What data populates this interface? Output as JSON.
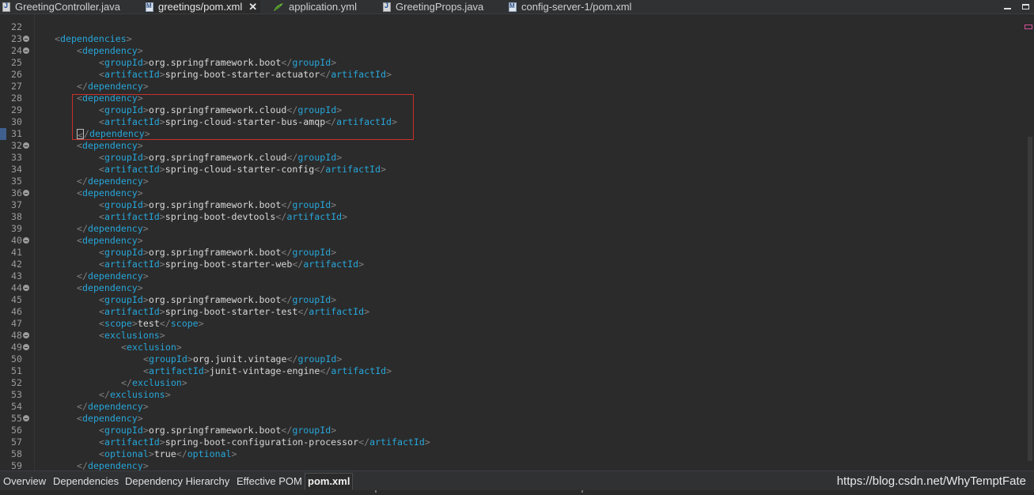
{
  "tabs": [
    {
      "label": "GreetingController.java",
      "icon": "java-file-icon",
      "active": false
    },
    {
      "label": "greetings/pom.xml",
      "icon": "maven-pom-icon",
      "active": true,
      "close": "✕"
    },
    {
      "label": "application.yml",
      "icon": "yaml-file-icon",
      "active": false
    },
    {
      "label": "GreetingProps.java",
      "icon": "java-file-icon",
      "active": false
    },
    {
      "label": "config-server-1/pom.xml",
      "icon": "maven-pom-icon",
      "active": false
    }
  ],
  "editor": {
    "lines": [
      {
        "n": "22",
        "indent": 0,
        "parts": []
      },
      {
        "n": "23",
        "fold": true,
        "indent": 1,
        "parts": [
          [
            "br",
            "<"
          ],
          [
            "tag",
            "dependencies"
          ],
          [
            "br",
            ">"
          ]
        ]
      },
      {
        "n": "24",
        "fold": true,
        "indent": 2,
        "parts": [
          [
            "br",
            "<"
          ],
          [
            "tag",
            "dependency"
          ],
          [
            "br",
            ">"
          ]
        ]
      },
      {
        "n": "25",
        "indent": 3,
        "parts": [
          [
            "br",
            "<"
          ],
          [
            "tag",
            "groupId"
          ],
          [
            "br",
            ">"
          ],
          [
            "txt",
            "org.springframework.boot"
          ],
          [
            "br",
            "</"
          ],
          [
            "tag",
            "groupId"
          ],
          [
            "br",
            ">"
          ]
        ]
      },
      {
        "n": "26",
        "indent": 3,
        "parts": [
          [
            "br",
            "<"
          ],
          [
            "tag",
            "artifactId"
          ],
          [
            "br",
            ">"
          ],
          [
            "txt",
            "spring-boot-starter-actuator"
          ],
          [
            "br",
            "</"
          ],
          [
            "tag",
            "artifactId"
          ],
          [
            "br",
            ">"
          ]
        ]
      },
      {
        "n": "27",
        "indent": 2,
        "parts": [
          [
            "br",
            "</"
          ],
          [
            "tag",
            "dependency"
          ],
          [
            "br",
            ">"
          ]
        ]
      },
      {
        "n": "28",
        "indent": 2,
        "parts": [
          [
            "br",
            "<"
          ],
          [
            "tag",
            "dependency"
          ],
          [
            "br",
            ">"
          ]
        ]
      },
      {
        "n": "29",
        "indent": 3,
        "parts": [
          [
            "br",
            "<"
          ],
          [
            "tag",
            "groupId"
          ],
          [
            "br",
            ">"
          ],
          [
            "txt",
            "org.springframework.cloud"
          ],
          [
            "br",
            "</"
          ],
          [
            "tag",
            "groupId"
          ],
          [
            "br",
            ">"
          ]
        ]
      },
      {
        "n": "30",
        "indent": 3,
        "parts": [
          [
            "br",
            "<"
          ],
          [
            "tag",
            "artifactId"
          ],
          [
            "br",
            ">"
          ],
          [
            "txt",
            "spring-cloud-starter-bus-amqp"
          ],
          [
            "br",
            "</"
          ],
          [
            "tag",
            "artifactId"
          ],
          [
            "br",
            ">"
          ]
        ]
      },
      {
        "n": "31",
        "indent": 2,
        "cursor": true,
        "parts": [
          [
            "br",
            "</"
          ],
          [
            "tag",
            "dependency"
          ],
          [
            "br",
            ">"
          ]
        ]
      },
      {
        "n": "32",
        "fold": true,
        "indent": 2,
        "parts": [
          [
            "br",
            "<"
          ],
          [
            "tag",
            "dependency"
          ],
          [
            "br",
            ">"
          ]
        ]
      },
      {
        "n": "33",
        "indent": 3,
        "parts": [
          [
            "br",
            "<"
          ],
          [
            "tag",
            "groupId"
          ],
          [
            "br",
            ">"
          ],
          [
            "txt",
            "org.springframework.cloud"
          ],
          [
            "br",
            "</"
          ],
          [
            "tag",
            "groupId"
          ],
          [
            "br",
            ">"
          ]
        ]
      },
      {
        "n": "34",
        "indent": 3,
        "parts": [
          [
            "br",
            "<"
          ],
          [
            "tag",
            "artifactId"
          ],
          [
            "br",
            ">"
          ],
          [
            "txt",
            "spring-cloud-starter-config"
          ],
          [
            "br",
            "</"
          ],
          [
            "tag",
            "artifactId"
          ],
          [
            "br",
            ">"
          ]
        ]
      },
      {
        "n": "35",
        "indent": 2,
        "parts": [
          [
            "br",
            "</"
          ],
          [
            "tag",
            "dependency"
          ],
          [
            "br",
            ">"
          ]
        ]
      },
      {
        "n": "36",
        "fold": true,
        "indent": 2,
        "parts": [
          [
            "br",
            "<"
          ],
          [
            "tag",
            "dependency"
          ],
          [
            "br",
            ">"
          ]
        ]
      },
      {
        "n": "37",
        "indent": 3,
        "parts": [
          [
            "br",
            "<"
          ],
          [
            "tag",
            "groupId"
          ],
          [
            "br",
            ">"
          ],
          [
            "txt",
            "org.springframework.boot"
          ],
          [
            "br",
            "</"
          ],
          [
            "tag",
            "groupId"
          ],
          [
            "br",
            ">"
          ]
        ]
      },
      {
        "n": "38",
        "indent": 3,
        "parts": [
          [
            "br",
            "<"
          ],
          [
            "tag",
            "artifactId"
          ],
          [
            "br",
            ">"
          ],
          [
            "txt",
            "spring-boot-devtools"
          ],
          [
            "br",
            "</"
          ],
          [
            "tag",
            "artifactId"
          ],
          [
            "br",
            ">"
          ]
        ]
      },
      {
        "n": "39",
        "indent": 2,
        "parts": [
          [
            "br",
            "</"
          ],
          [
            "tag",
            "dependency"
          ],
          [
            "br",
            ">"
          ]
        ]
      },
      {
        "n": "40",
        "fold": true,
        "indent": 2,
        "parts": [
          [
            "br",
            "<"
          ],
          [
            "tag",
            "dependency"
          ],
          [
            "br",
            ">"
          ]
        ]
      },
      {
        "n": "41",
        "indent": 3,
        "parts": [
          [
            "br",
            "<"
          ],
          [
            "tag",
            "groupId"
          ],
          [
            "br",
            ">"
          ],
          [
            "txt",
            "org.springframework.boot"
          ],
          [
            "br",
            "</"
          ],
          [
            "tag",
            "groupId"
          ],
          [
            "br",
            ">"
          ]
        ]
      },
      {
        "n": "42",
        "indent": 3,
        "parts": [
          [
            "br",
            "<"
          ],
          [
            "tag",
            "artifactId"
          ],
          [
            "br",
            ">"
          ],
          [
            "txt",
            "spring-boot-starter-web"
          ],
          [
            "br",
            "</"
          ],
          [
            "tag",
            "artifactId"
          ],
          [
            "br",
            ">"
          ]
        ]
      },
      {
        "n": "43",
        "indent": 2,
        "parts": [
          [
            "br",
            "</"
          ],
          [
            "tag",
            "dependency"
          ],
          [
            "br",
            ">"
          ]
        ]
      },
      {
        "n": "44",
        "fold": true,
        "indent": 2,
        "parts": [
          [
            "br",
            "<"
          ],
          [
            "tag",
            "dependency"
          ],
          [
            "br",
            ">"
          ]
        ]
      },
      {
        "n": "45",
        "indent": 3,
        "parts": [
          [
            "br",
            "<"
          ],
          [
            "tag",
            "groupId"
          ],
          [
            "br",
            ">"
          ],
          [
            "txt",
            "org.springframework.boot"
          ],
          [
            "br",
            "</"
          ],
          [
            "tag",
            "groupId"
          ],
          [
            "br",
            ">"
          ]
        ]
      },
      {
        "n": "46",
        "indent": 3,
        "parts": [
          [
            "br",
            "<"
          ],
          [
            "tag",
            "artifactId"
          ],
          [
            "br",
            ">"
          ],
          [
            "txt",
            "spring-boot-starter-test"
          ],
          [
            "br",
            "</"
          ],
          [
            "tag",
            "artifactId"
          ],
          [
            "br",
            ">"
          ]
        ]
      },
      {
        "n": "47",
        "indent": 3,
        "parts": [
          [
            "br",
            "<"
          ],
          [
            "tag",
            "scope"
          ],
          [
            "br",
            ">"
          ],
          [
            "txt",
            "test"
          ],
          [
            "br",
            "</"
          ],
          [
            "tag",
            "scope"
          ],
          [
            "br",
            ">"
          ]
        ]
      },
      {
        "n": "48",
        "fold": true,
        "indent": 3,
        "parts": [
          [
            "br",
            "<"
          ],
          [
            "tag",
            "exclusions"
          ],
          [
            "br",
            ">"
          ]
        ]
      },
      {
        "n": "49",
        "fold": true,
        "indent": 4,
        "parts": [
          [
            "br",
            "<"
          ],
          [
            "tag",
            "exclusion"
          ],
          [
            "br",
            ">"
          ]
        ]
      },
      {
        "n": "50",
        "indent": 5,
        "parts": [
          [
            "br",
            "<"
          ],
          [
            "tag",
            "groupId"
          ],
          [
            "br",
            ">"
          ],
          [
            "txt",
            "org.junit.vintage"
          ],
          [
            "br",
            "</"
          ],
          [
            "tag",
            "groupId"
          ],
          [
            "br",
            ">"
          ]
        ]
      },
      {
        "n": "51",
        "indent": 5,
        "parts": [
          [
            "br",
            "<"
          ],
          [
            "tag",
            "artifactId"
          ],
          [
            "br",
            ">"
          ],
          [
            "txt",
            "junit-vintage-engine"
          ],
          [
            "br",
            "</"
          ],
          [
            "tag",
            "artifactId"
          ],
          [
            "br",
            ">"
          ]
        ]
      },
      {
        "n": "52",
        "indent": 4,
        "parts": [
          [
            "br",
            "</"
          ],
          [
            "tag",
            "exclusion"
          ],
          [
            "br",
            ">"
          ]
        ]
      },
      {
        "n": "53",
        "indent": 3,
        "parts": [
          [
            "br",
            "</"
          ],
          [
            "tag",
            "exclusions"
          ],
          [
            "br",
            ">"
          ]
        ]
      },
      {
        "n": "54",
        "indent": 2,
        "parts": [
          [
            "br",
            "</"
          ],
          [
            "tag",
            "dependency"
          ],
          [
            "br",
            ">"
          ]
        ]
      },
      {
        "n": "55",
        "fold": true,
        "indent": 2,
        "parts": [
          [
            "br",
            "<"
          ],
          [
            "tag",
            "dependency"
          ],
          [
            "br",
            ">"
          ]
        ]
      },
      {
        "n": "56",
        "indent": 3,
        "parts": [
          [
            "br",
            "<"
          ],
          [
            "tag",
            "groupId"
          ],
          [
            "br",
            ">"
          ],
          [
            "txt",
            "org.springframework.boot"
          ],
          [
            "br",
            "</"
          ],
          [
            "tag",
            "groupId"
          ],
          [
            "br",
            ">"
          ]
        ]
      },
      {
        "n": "57",
        "indent": 3,
        "parts": [
          [
            "br",
            "<"
          ],
          [
            "tag",
            "artifactId"
          ],
          [
            "br",
            ">"
          ],
          [
            "txt",
            "spring-boot-configuration-processor"
          ],
          [
            "br",
            "</"
          ],
          [
            "tag",
            "artifactId"
          ],
          [
            "br",
            ">"
          ]
        ]
      },
      {
        "n": "58",
        "indent": 3,
        "parts": [
          [
            "br",
            "<"
          ],
          [
            "tag",
            "optional"
          ],
          [
            "br",
            ">"
          ],
          [
            "txt",
            "true"
          ],
          [
            "br",
            "</"
          ],
          [
            "tag",
            "optional"
          ],
          [
            "br",
            ">"
          ]
        ]
      },
      {
        "n": "59",
        "indent": 2,
        "parts": [
          [
            "br",
            "</"
          ],
          [
            "tag",
            "dependency"
          ],
          [
            "br",
            ">"
          ]
        ]
      }
    ]
  },
  "bottom_tabs": [
    {
      "label": "Overview",
      "active": false
    },
    {
      "label": "Dependencies",
      "active": false
    },
    {
      "label": "Dependency Hierarchy",
      "active": false
    },
    {
      "label": "Effective POM",
      "active": false
    },
    {
      "label": "pom.xml",
      "active": true
    }
  ],
  "watermark": "https://blog.csdn.net/WhyTemptFate",
  "colors": {
    "background": "#2b2b2b",
    "tag": "#27a6d9",
    "bracket": "#808080",
    "text": "#d8d8d8",
    "highlight_border": "#c8322e"
  }
}
